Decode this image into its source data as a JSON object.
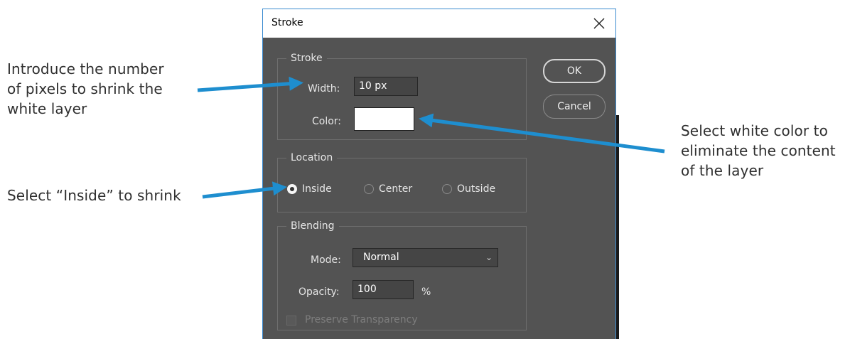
{
  "annotations": {
    "width_note_1": "Introduce the number",
    "width_note_2": "of pixels to shrink the",
    "width_note_3": "white layer",
    "inside_note": "Select “Inside” to shrink",
    "color_note_1": "Select white color to",
    "color_note_2": "eliminate the content",
    "color_note_3": "of the layer",
    "arrow_color": "#1e8ecf"
  },
  "dialog": {
    "title": "Stroke",
    "close_icon": "close-icon",
    "stroke_group": {
      "legend": "Stroke",
      "width_label": "Width:",
      "width_value": "10 px",
      "color_label": "Color:",
      "color_value": "#ffffff"
    },
    "location_group": {
      "legend": "Location",
      "options": [
        {
          "label": "Inside",
          "checked": true
        },
        {
          "label": "Center",
          "checked": false
        },
        {
          "label": "Outside",
          "checked": false
        }
      ]
    },
    "blending_group": {
      "legend": "Blending",
      "mode_label": "Mode:",
      "mode_value": "Normal",
      "opacity_label": "Opacity:",
      "opacity_value": "100",
      "opacity_unit": "%",
      "preserve_label": "Preserve Transparency",
      "preserve_checked": false,
      "preserve_enabled": false
    },
    "buttons": {
      "ok": "OK",
      "cancel": "Cancel"
    }
  }
}
